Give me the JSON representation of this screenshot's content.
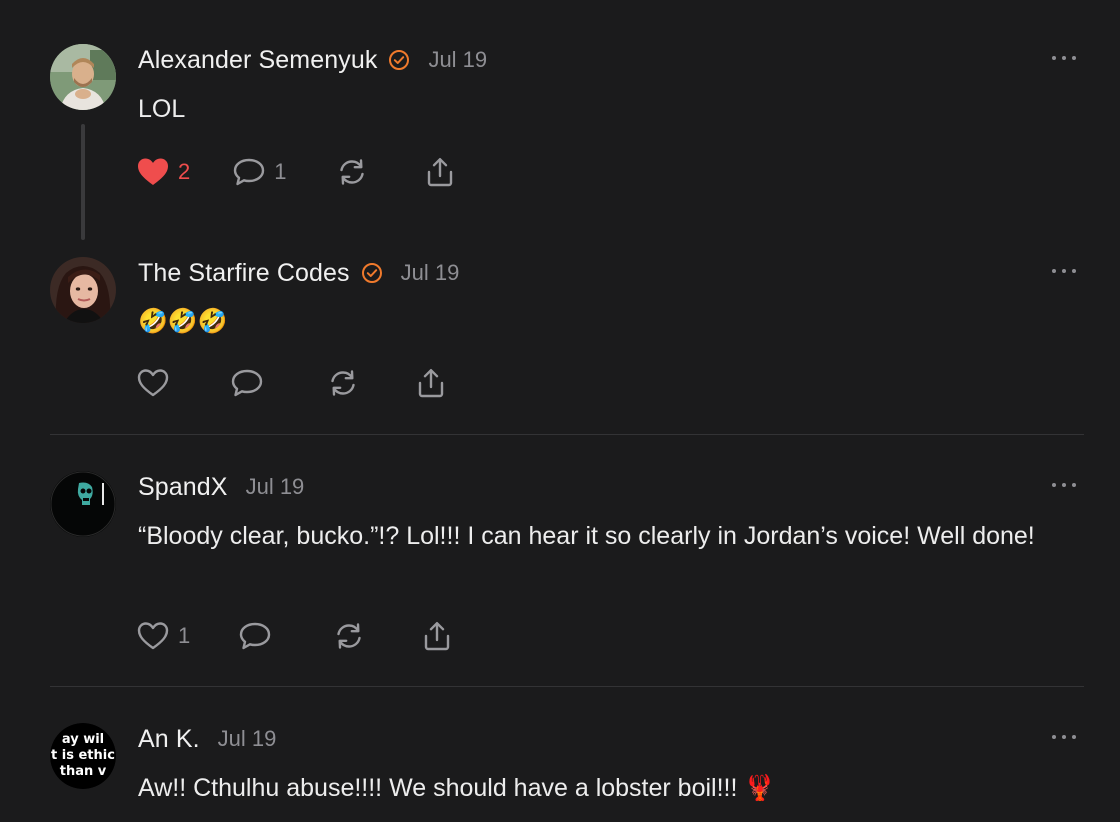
{
  "comments": [
    {
      "author": "Alexander Semenyuk",
      "verified": true,
      "date": "Jul 19",
      "text": "LOL",
      "likes": "2",
      "liked": true,
      "replies": "1"
    },
    {
      "author": "The Starfire Codes",
      "verified": true,
      "date": "Jul 19",
      "text": "🤣🤣🤣",
      "likes": "",
      "liked": false,
      "replies": ""
    },
    {
      "author": "SpandX",
      "verified": false,
      "date": "Jul 19",
      "text": "“Bloody clear, bucko.”!? Lol!!! I can hear it so clearly in Jordan’s voice! Well done!",
      "likes": "1",
      "liked": false,
      "replies": ""
    },
    {
      "author": "An K.",
      "verified": false,
      "date": "Jul 19",
      "text": "Aw!! Cthulhu abuse!!!! We should have a lobster boil!!! 🦞",
      "avatar_text": [
        "ay wil",
        "t is ethic",
        "than v"
      ]
    }
  ],
  "colors": {
    "background": "#1b1b1c",
    "accent_orange": "#f07a2c",
    "like_red": "#ef4d4d",
    "muted": "#8e8e93"
  },
  "icons": {
    "verified": "verified-badge-icon",
    "like": "heart-icon",
    "reply": "comment-bubble-icon",
    "restack": "restack-icon",
    "share": "share-icon",
    "more": "more-options-icon"
  }
}
